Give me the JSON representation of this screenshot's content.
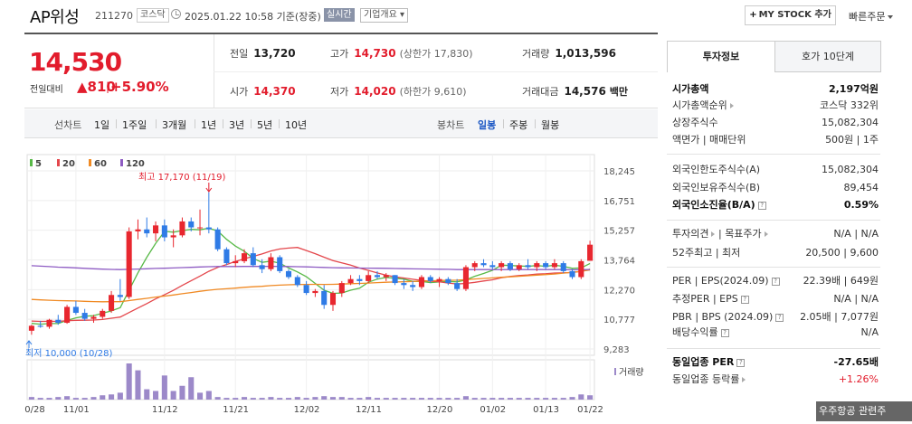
{
  "header": {
    "name": "AP위성",
    "code": "211270",
    "market": "코스닥",
    "timestamp": "2025.01.22 10:58 기준(장중)",
    "realtime": "실시간",
    "company_info": "기업개요",
    "my_stock": "MY STOCK 추가",
    "quick_order": "빠른주문"
  },
  "price": {
    "current": "14,530",
    "prev_label": "전일대비",
    "change": "▲810",
    "sep": "|",
    "change_pct": "+5.90%",
    "colors": {
      "up": "#e21c2c"
    }
  },
  "stats": {
    "prev_close_label": "전일",
    "prev_close": "13,720",
    "high_label": "고가",
    "high": "14,730",
    "upper_limit": "(상한가 17,830)",
    "volume_label": "거래량",
    "volume": "1,013,596",
    "open_label": "시가",
    "open": "14,370",
    "low_label": "저가",
    "low": "14,020",
    "lower_limit": "(하한가 9,610)",
    "amount_label": "거래대금",
    "amount": "14,576",
    "amount_unit": "백만"
  },
  "period_tabs": {
    "line_label": "선차트",
    "line": [
      "1일",
      "1주일",
      "3개월",
      "1년",
      "3년",
      "5년",
      "10년"
    ],
    "candle_label": "봉차트",
    "candle": [
      "일봉",
      "주봉",
      "월봉"
    ],
    "active_candle": "일봉"
  },
  "chart_data": {
    "type": "candlestick",
    "legend": [
      {
        "name": "5",
        "color": "#58b947"
      },
      {
        "name": "20",
        "color": "#e4474c"
      },
      {
        "name": "60",
        "color": "#f08a24"
      },
      {
        "name": "120",
        "color": "#8e5cc3"
      }
    ],
    "y_ticks": [
      "18,245",
      "16,751",
      "15,257",
      "13,764",
      "12,270",
      "10,777",
      "9,283"
    ],
    "ylim": [
      9283,
      18245
    ],
    "x_ticks": [
      "10/28",
      "11/01",
      "11/12",
      "11/21",
      "12/02",
      "12/11",
      "12/20",
      "01/02",
      "01/13",
      "01/22"
    ],
    "high_marker": "최고 17,170 (11/19)",
    "low_marker": "최저 10,000 (10/28)",
    "volume_label": "거래량",
    "candles": [
      [
        10200,
        10500,
        10000,
        10450
      ],
      [
        10450,
        10700,
        10350,
        10400
      ],
      [
        10400,
        10800,
        10300,
        10750
      ],
      [
        10750,
        11000,
        10500,
        10600
      ],
      [
        10600,
        11500,
        10550,
        11400
      ],
      [
        11400,
        11700,
        11000,
        11100
      ],
      [
        11100,
        11300,
        10700,
        10800
      ],
      [
        10800,
        11000,
        10600,
        10900
      ],
      [
        10900,
        11300,
        10800,
        11200
      ],
      [
        11200,
        12200,
        11100,
        12000
      ],
      [
        12000,
        12800,
        11700,
        11900
      ],
      [
        11900,
        15400,
        11800,
        15200
      ],
      [
        15200,
        15800,
        14800,
        15300
      ],
      [
        15300,
        15900,
        14900,
        15100
      ],
      [
        15100,
        15700,
        14700,
        15500
      ],
      [
        15500,
        15800,
        14700,
        14900
      ],
      [
        14900,
        15300,
        14400,
        15000
      ],
      [
        15000,
        15900,
        14900,
        15700
      ],
      [
        15700,
        15900,
        15200,
        15400
      ],
      [
        15400,
        16300,
        15000,
        15400
      ],
      [
        15400,
        17170,
        15100,
        15300
      ],
      [
        15300,
        15400,
        14200,
        14300
      ],
      [
        14300,
        14400,
        13500,
        13600
      ],
      [
        13600,
        14000,
        13400,
        13700
      ],
      [
        13700,
        14300,
        13600,
        14100
      ],
      [
        14100,
        14400,
        13400,
        13500
      ],
      [
        13500,
        13800,
        13100,
        13300
      ],
      [
        13300,
        14100,
        13200,
        13900
      ],
      [
        13900,
        14000,
        13100,
        13200
      ],
      [
        13200,
        13300,
        12800,
        12900
      ],
      [
        12900,
        13000,
        12400,
        12500
      ],
      [
        12500,
        12700,
        12000,
        12100
      ],
      [
        12100,
        12300,
        11900,
        12200
      ],
      [
        12200,
        12500,
        11300,
        11500
      ],
      [
        11500,
        12200,
        11200,
        12100
      ],
      [
        12100,
        12700,
        11900,
        12600
      ],
      [
        12600,
        13000,
        12500,
        12800
      ],
      [
        12800,
        13000,
        12500,
        12700
      ],
      [
        12700,
        13200,
        12600,
        13000
      ],
      [
        13000,
        13200,
        12800,
        12900
      ],
      [
        12900,
        13100,
        12700,
        13000
      ],
      [
        13000,
        13000,
        12500,
        12600
      ],
      [
        12600,
        12800,
        12300,
        12500
      ],
      [
        12500,
        12700,
        12200,
        12400
      ],
      [
        12400,
        13000,
        12300,
        12900
      ],
      [
        12900,
        13000,
        12600,
        12700
      ],
      [
        12700,
        12900,
        12400,
        12800
      ],
      [
        12800,
        12900,
        12500,
        12600
      ],
      [
        12600,
        12800,
        12200,
        12300
      ],
      [
        12300,
        13500,
        12200,
        13400
      ],
      [
        13400,
        13700,
        13200,
        13600
      ],
      [
        13600,
        13800,
        13400,
        13500
      ],
      [
        13500,
        13700,
        13300,
        13400
      ],
      [
        13400,
        13700,
        13200,
        13600
      ],
      [
        13600,
        13700,
        13200,
        13300
      ],
      [
        13300,
        13600,
        13200,
        13500
      ],
      [
        13500,
        13800,
        13300,
        13400
      ],
      [
        13400,
        13700,
        13200,
        13600
      ],
      [
        13600,
        13700,
        13300,
        13400
      ],
      [
        13400,
        13800,
        13300,
        13600
      ],
      [
        13600,
        13700,
        13100,
        13200
      ],
      [
        13200,
        13300,
        12800,
        12900
      ],
      [
        12900,
        13800,
        12800,
        13700
      ],
      [
        13720,
        14730,
        14020,
        14530
      ]
    ],
    "volumes": [
      0.3,
      0.2,
      0.2,
      0.3,
      0.4,
      0.2,
      0.2,
      0.3,
      0.5,
      0.6,
      0.8,
      4.2,
      3.4,
      1.2,
      1.0,
      2.8,
      1.0,
      1.6,
      2.6,
      0.8,
      1.0,
      0.3,
      0.2,
      0.2,
      0.3,
      0.2,
      0.2,
      0.3,
      0.2,
      0.2,
      0.3,
      0.2,
      0.3,
      0.4,
      0.3,
      0.3,
      0.2,
      0.2,
      0.3,
      0.2,
      0.2,
      0.2,
      0.2,
      0.2,
      0.2,
      0.2,
      0.2,
      0.2,
      0.2,
      0.4,
      0.2,
      0.2,
      0.2,
      0.2,
      0.2,
      0.2,
      0.2,
      0.2,
      0.2,
      0.2,
      0.2,
      0.3,
      0.6,
      0.5
    ]
  },
  "side": {
    "tab_active": "투자정보",
    "tab_other": "호가 10단계",
    "market_cap_label": "시가총액",
    "market_cap": "2,197억원",
    "cap_rank_label": "시가총액순위",
    "cap_rank": "코스닥 332위",
    "shares_label": "상장주식수",
    "shares": "15,082,304",
    "par_label": "액면가 | 매매단위",
    "par": "500원 | 1주",
    "foreign_limit_label": "외국인한도주식수(A)",
    "foreign_limit": "15,082,304",
    "foreign_hold_label": "외국인보유주식수(B)",
    "foreign_hold": "89,454",
    "foreign_rate_label": "외국인소진율(B/A)",
    "foreign_rate": "0.59%",
    "opinion_label": "투자의견",
    "target_label": "목표주가",
    "opinion": "N/A | N/A",
    "week52_label": "52주최고 | 최저",
    "week52": "20,500 | 9,600",
    "per_label": "PER | EPS(2024.09)",
    "per": "22.39배 | 649원",
    "est_per_label": "추정PER | EPS",
    "est_per": "N/A | N/A",
    "pbr_label": "PBR | BPS (2024.09)",
    "pbr": "2.05배 | 7,077원",
    "div_label": "배당수익률",
    "div": "N/A",
    "ind_per_label": "동일업종 PER",
    "ind_per": "-27.65배",
    "ind_rate_label": "동일업종 등락률",
    "ind_rate": "+1.26%"
  },
  "ads_label": "우주항공 관련주"
}
